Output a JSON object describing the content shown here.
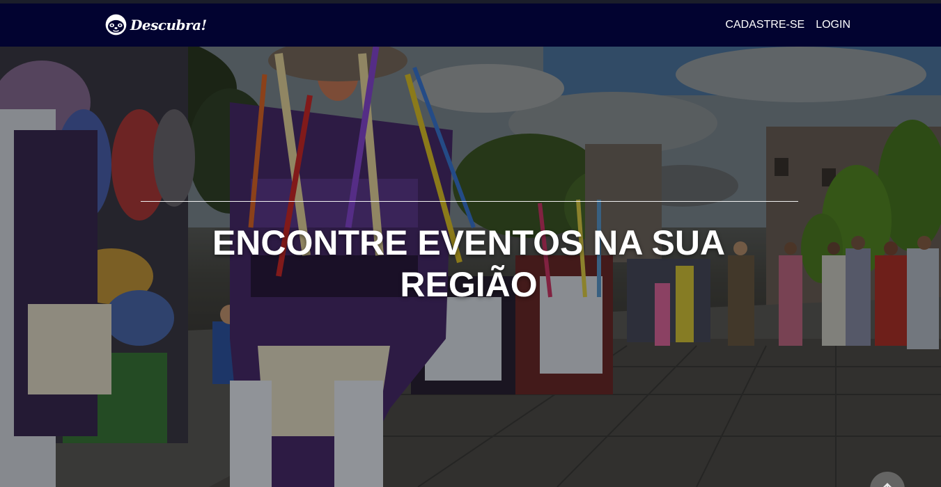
{
  "navbar": {
    "brand_name": "Descubra!",
    "brand_icon": "sloth-face-icon",
    "links": [
      "CADASTRE-SE",
      "LOGIN"
    ]
  },
  "hero": {
    "title": "ENCONTRE EVENTOS NA SUA REGIÃO"
  },
  "scroll_top": {
    "icon": "arrow-up-icon"
  },
  "colors": {
    "navbar_bg": "#020330",
    "text": "#ffffff"
  }
}
